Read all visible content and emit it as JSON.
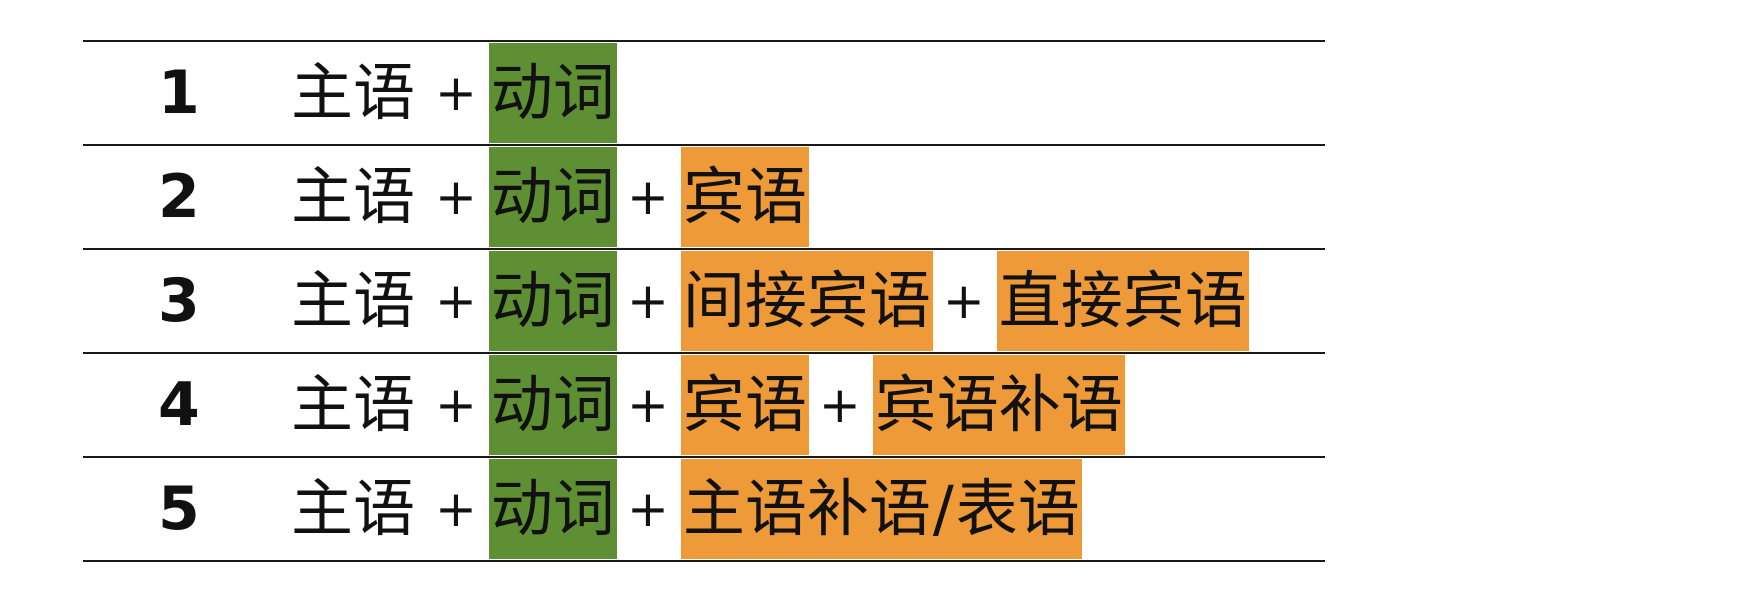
{
  "rows": [
    {
      "number": "1",
      "subject": "主语",
      "plus": "+",
      "verb": "动词",
      "parts": []
    },
    {
      "number": "2",
      "subject": "主语",
      "plus": "+",
      "verb": "动词",
      "parts": [
        "宾语"
      ]
    },
    {
      "number": "3",
      "subject": "主语",
      "plus": "+",
      "verb": "动词",
      "parts": [
        "间接宾语",
        "直接宾语"
      ]
    },
    {
      "number": "4",
      "subject": "主语",
      "plus": "+",
      "verb": "动词",
      "parts": [
        "宾语",
        "宾语补语"
      ]
    },
    {
      "number": "5",
      "subject": "主语",
      "plus": "+",
      "verb": "动词",
      "parts": [
        "主语补语",
        "表语"
      ],
      "slash": "/"
    }
  ],
  "colors": {
    "verb_highlight": "#5f8f33",
    "object_highlight": "#ee9a38",
    "rule_line": "#1a1a1a"
  }
}
